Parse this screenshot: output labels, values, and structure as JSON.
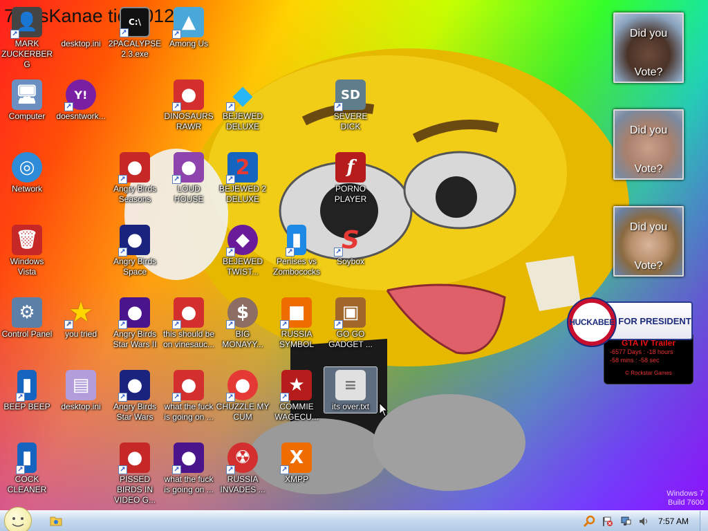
{
  "wallpaper": {
    "title": "7 ossKanae tion 012",
    "watermark_line1": "Windows 7",
    "watermark_line2": "Build 7600"
  },
  "icons": [
    {
      "label": "MARK ZUCKERBERG",
      "name": "icon-mark-zuckerberg",
      "glyph": "👤",
      "color": "#444"
    },
    {
      "label": "desktop.ini",
      "name": "icon-desktop-ini-1",
      "glyph": "",
      "color": "transparent"
    },
    {
      "label": "2PACALYPSE 2.3.exe",
      "name": "icon-2pacalypse",
      "glyph": "C:\\",
      "color": "#111"
    },
    {
      "label": "Among Us",
      "name": "icon-among-us",
      "glyph": "▲",
      "color": "#4aa8d8"
    },
    {
      "label": "Computer",
      "name": "icon-computer",
      "glyph": "🖥",
      "color": "#6a8fc0"
    },
    {
      "label": "doesntwork...",
      "name": "icon-doesntwork",
      "glyph": "Y!",
      "color": "#7b1fa2"
    },
    {
      "label": "DINOSAURS RAWR",
      "name": "icon-dinosaurs-rawr",
      "glyph": "●",
      "color": "#d32f2f"
    },
    {
      "label": "BEJEWED DELUXE",
      "name": "icon-bejewed-deluxe",
      "glyph": "◆",
      "color": "#1e88e5"
    },
    {
      "label": "SEVERE DICK",
      "name": "icon-severe-dick",
      "glyph": "SD",
      "color": "#607d8b"
    },
    {
      "label": "Network",
      "name": "icon-network",
      "glyph": "◎",
      "color": "#2e8bd8"
    },
    {
      "label": "Angry Birds Seasons",
      "name": "icon-angry-birds-seasons",
      "glyph": "●",
      "color": "#c62828"
    },
    {
      "label": "LOUD HOUSE",
      "name": "icon-loud-house",
      "glyph": "●",
      "color": "#8e44ad"
    },
    {
      "label": "BEJEWED 2 DELUXE",
      "name": "icon-bejewed-2-deluxe",
      "glyph": "2",
      "color": "#1565c0"
    },
    {
      "label": "PORNO PLAYER",
      "name": "icon-porno-player",
      "glyph": "f",
      "color": "#b71c1c"
    },
    {
      "label": "Windows Vista",
      "name": "icon-windows-vista",
      "glyph": "🗑",
      "color": "#c62828"
    },
    {
      "label": "Angry Birds Space",
      "name": "icon-angry-birds-space",
      "glyph": "●",
      "color": "#1a237e"
    },
    {
      "label": "BEJEWED TWIST...",
      "name": "icon-bejewed-twist",
      "glyph": "◆",
      "color": "#6a1b9a"
    },
    {
      "label": "Penises vs Zombococks",
      "name": "icon-penises-vs-zombococks",
      "glyph": "▮",
      "color": "#1e88e5"
    },
    {
      "label": "Soybox",
      "name": "icon-soybox",
      "glyph": "S",
      "color": "#e53935"
    },
    {
      "label": "Control Panel",
      "name": "icon-control-panel",
      "glyph": "⚙",
      "color": "#5c7fa8"
    },
    {
      "label": "you tried",
      "name": "icon-you-tried",
      "glyph": "★",
      "color": "transparent"
    },
    {
      "label": "Angry Birds Star Wars II",
      "name": "icon-angry-birds-star-wars-ii",
      "glyph": "●",
      "color": "#4a148c"
    },
    {
      "label": "this should be on vinesauc...",
      "name": "icon-this-should-be-on-vinesauce",
      "glyph": "●",
      "color": "#d32f2f"
    },
    {
      "label": "BIG MONAYY...",
      "name": "icon-big-monayy",
      "glyph": "$",
      "color": "#8d6e63"
    },
    {
      "label": "RUSSIA SYMBOL",
      "name": "icon-russia-symbol",
      "glyph": "■",
      "color": "#ef6c00"
    },
    {
      "label": "GO GO GADGET ...",
      "name": "icon-go-go-gadget",
      "glyph": "▣",
      "color": "#a1672a"
    },
    {
      "label": "BEEP BEEP",
      "name": "icon-beep-beep",
      "glyph": "▮",
      "color": "#1565c0"
    },
    {
      "label": "desktop.ini",
      "name": "icon-desktop-ini-2",
      "glyph": "▤",
      "color": "#b39ddb"
    },
    {
      "label": "Angry Birds Star Wars",
      "name": "icon-angry-birds-star-wars",
      "glyph": "●",
      "color": "#1a237e"
    },
    {
      "label": "what the fuck is going on ...",
      "name": "icon-what-the-fuck-1",
      "glyph": "●",
      "color": "#d32f2f"
    },
    {
      "label": "CHUZZLE MY CUM",
      "name": "icon-chuzzle-my-cum",
      "glyph": "●",
      "color": "#e53935"
    },
    {
      "label": "COMMIE WAGECU...",
      "name": "icon-commie-wagecuck",
      "glyph": "★",
      "color": "#b71c1c"
    },
    {
      "label": "its over.txt",
      "name": "icon-its-over-txt",
      "glyph": "≡",
      "color": "#e0e0e0"
    },
    {
      "label": "COCK CLEANER",
      "name": "icon-cock-cleaner",
      "glyph": "▮",
      "color": "#1565c0"
    },
    {
      "label": "PISSED BIRDS IN VIDEO G...",
      "name": "icon-pissed-birds",
      "glyph": "●",
      "color": "#c62828"
    },
    {
      "label": "what the fuck is going on ...",
      "name": "icon-what-the-fuck-2",
      "glyph": "●",
      "color": "#4a148c"
    },
    {
      "label": "RUSSIA INVADES ...",
      "name": "icon-russia-invades",
      "glyph": "☢",
      "color": "#d32f2f"
    },
    {
      "label": "XMPP",
      "name": "icon-xmpp",
      "glyph": "X",
      "color": "#ef6c00"
    }
  ],
  "gadgets": [
    {
      "line1": "Did you",
      "line2": "Vote?",
      "face": "#6b4a3a"
    },
    {
      "line1": "Did you",
      "line2": "Vote?",
      "face": "#c9a08a"
    },
    {
      "line1": "Did you",
      "line2": "Vote?",
      "face": "#d8b49a"
    }
  ],
  "huckabee": {
    "name": "HUCKABEE",
    "tagline": "FOR PRESIDENT"
  },
  "gta": {
    "title": "GTA IV Trailer",
    "days": "-6577 Days : -18 hours",
    "mins": "-58 mins : -58 sec",
    "footer": "© Rockstar Games"
  },
  "taskbar": {
    "clock": "7:57 AM"
  }
}
